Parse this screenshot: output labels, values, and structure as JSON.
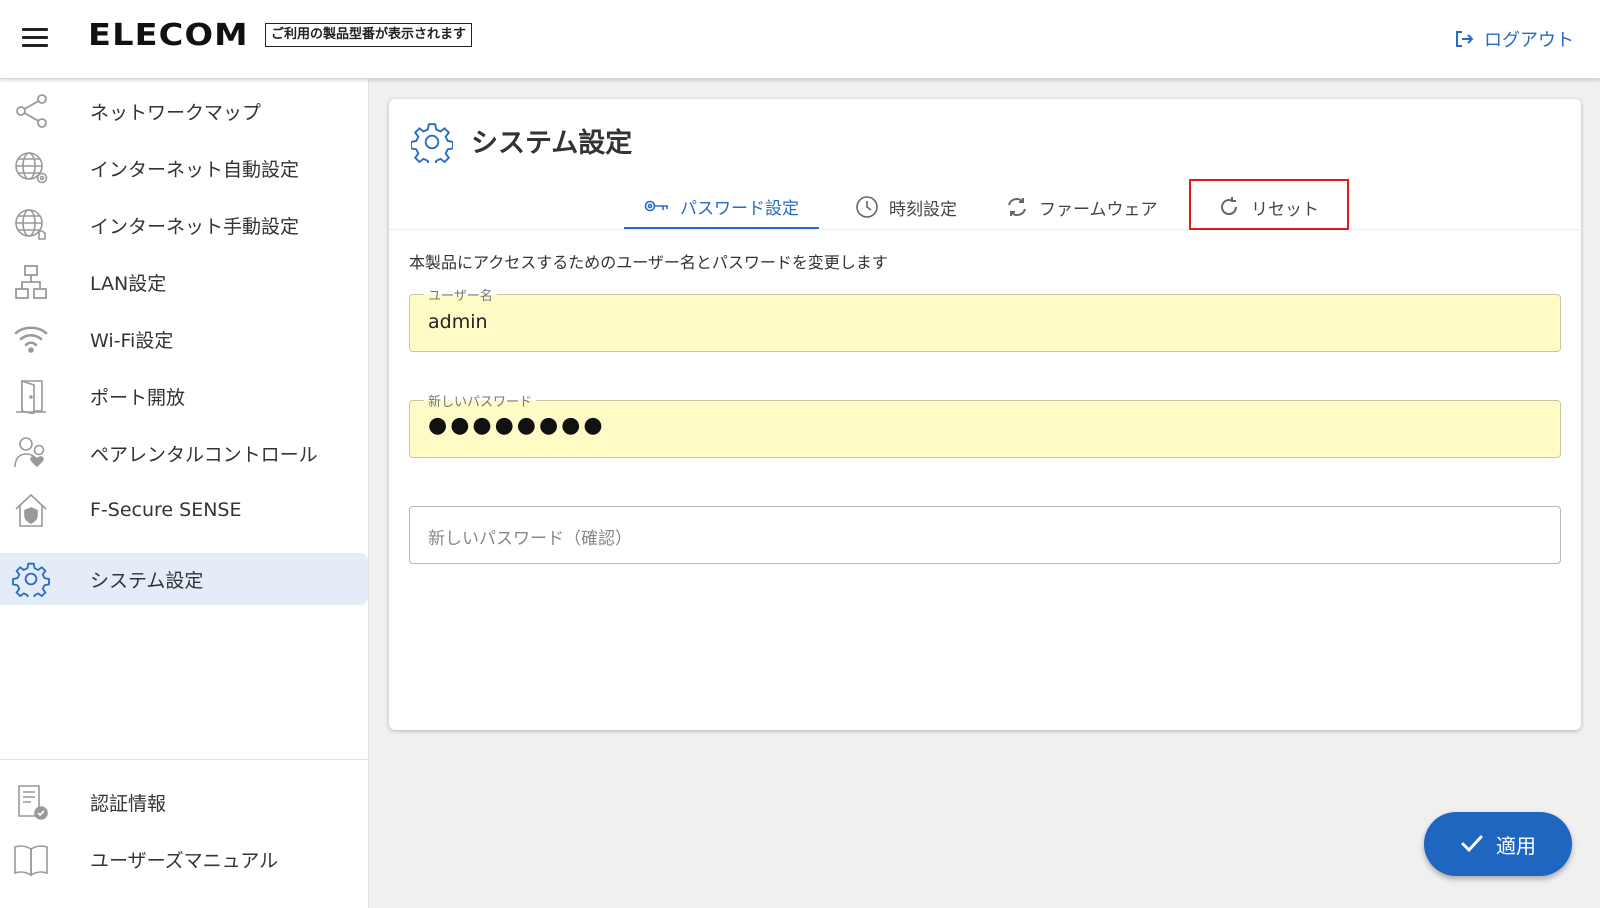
{
  "header": {
    "logo": "ELECOM",
    "model_notice": "ご利用の製品型番が表示されます",
    "logout_label": "ログアウト"
  },
  "sidebar": {
    "items": [
      {
        "label": "ネットワークマップ",
        "icon": "network-map-icon"
      },
      {
        "label": "インターネット自動設定",
        "icon": "globe-auto-icon"
      },
      {
        "label": "インターネット手動設定",
        "icon": "globe-manual-icon"
      },
      {
        "label": "LAN設定",
        "icon": "lan-icon"
      },
      {
        "label": "Wi-Fi設定",
        "icon": "wifi-icon"
      },
      {
        "label": "ポート開放",
        "icon": "door-icon"
      },
      {
        "label": "ペアレンタルコントロール",
        "icon": "parental-icon"
      },
      {
        "label": "F-Secure SENSE",
        "icon": "shield-house-icon"
      },
      {
        "label": "システム設定",
        "icon": "gear-icon",
        "active": true
      }
    ],
    "bottom_items": [
      {
        "label": "認証情報",
        "icon": "certificate-icon"
      },
      {
        "label": "ユーザーズマニュアル",
        "icon": "manual-book-icon"
      }
    ]
  },
  "main": {
    "title": "システム設定",
    "tabs": [
      {
        "label": "パスワード設定",
        "icon": "key-icon",
        "active": true
      },
      {
        "label": "時刻設定",
        "icon": "clock-icon"
      },
      {
        "label": "ファームウェア",
        "icon": "sync-icon"
      },
      {
        "label": "リセット",
        "icon": "reset-icon"
      }
    ],
    "description": "本製品にアクセスするためのユーザー名とパスワードを変更します",
    "fields": {
      "username": {
        "label": "ユーザー名",
        "value": "admin"
      },
      "new_password": {
        "label": "新しいパスワード",
        "value": "●●●●●●●●"
      },
      "confirm_password": {
        "placeholder": "新しいパスワード（確認）",
        "value": ""
      }
    }
  },
  "apply_button": {
    "label": "適用"
  },
  "colors": {
    "accent": "#1f66c1",
    "highlight": "#e41818",
    "field_fill": "#fffbc6",
    "active_nav": "#e3ecf7"
  }
}
